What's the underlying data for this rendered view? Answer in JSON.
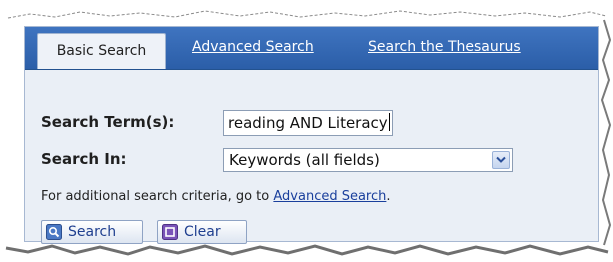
{
  "tabs": {
    "active_label": "Basic Search",
    "advanced_label": "Advanced Search",
    "thesaurus_label": "Search the Thesaurus"
  },
  "form": {
    "search_term_label": "Search Term(s):",
    "search_term_value": "reading AND Literacy",
    "search_in_label": "Search In:",
    "search_in_value": "Keywords (all fields)"
  },
  "hint": {
    "prefix": "For additional search criteria, go to ",
    "link": "Advanced Search",
    "suffix": "."
  },
  "buttons": {
    "search_label": "Search",
    "clear_label": "Clear"
  },
  "icons": {
    "search_button": "magnifier-icon",
    "clear_button": "clear-square-icon",
    "select": "chevron-down-icon"
  },
  "colors": {
    "tabbar": "#2f66b3",
    "panel": "#eaeff6",
    "link": "#1a3f9c"
  }
}
